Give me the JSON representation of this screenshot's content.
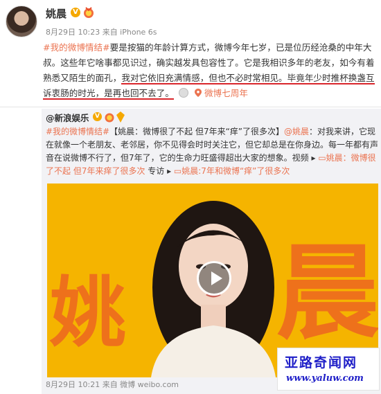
{
  "author": {
    "name": "姚晨",
    "verified_badge": "V",
    "meta": "8月29日 10:23 来自 iPhone 6s"
  },
  "post": {
    "hashtag": "#我的微博情结#",
    "text_part1": "要是按猫的年龄计算方式，微博今年七岁，已是位历经沧桑的中年大叔。这些年它啥事都见识过，确实越发具包容性了。它是我相识多年的老友，如今有着熟悉又陌生的面孔，",
    "highlight1": "我对它依旧充满情感，但也不必时常相见。毕竟年少时推杯换盏互诉衷肠的时光，是再也回不去了。",
    "location_tag": "微博七周年"
  },
  "repost": {
    "source_name": "@新浪娱乐",
    "verified_badge": "V",
    "hashtag1": "#我的微博情结#",
    "title": "【姚晨：微博很了不起 但7年来“痒”了很多次】",
    "mention": "@姚晨",
    "body": "：对我来讲，它现在就像一个老朋友、老邻居，你不见得会时时关注它，但它却总是在你身边。每一年都有声音在说微博不行了，但7年了，它的生命力旺盛得超出大家的想象。视频 ▸",
    "video_link": "姚晨：微博很了不起 但7年来痒了很多次",
    "interview": " 专访 ▸ ",
    "video_link2": "姚晨:7年和微博“痒”了很多次",
    "footer": "8月29日 10:21 来自 微博 weibo.com"
  },
  "video": {
    "calligraphy_left": "姚",
    "calligraphy_right": "晨"
  },
  "watermark": {
    "title": "亚路奇闻网",
    "url": "www.yaluw.com"
  },
  "colors": {
    "link": "#eb7350",
    "underline": "#d9252a",
    "video_bg": "#f5b400",
    "watermark": "#1f1fc8"
  }
}
